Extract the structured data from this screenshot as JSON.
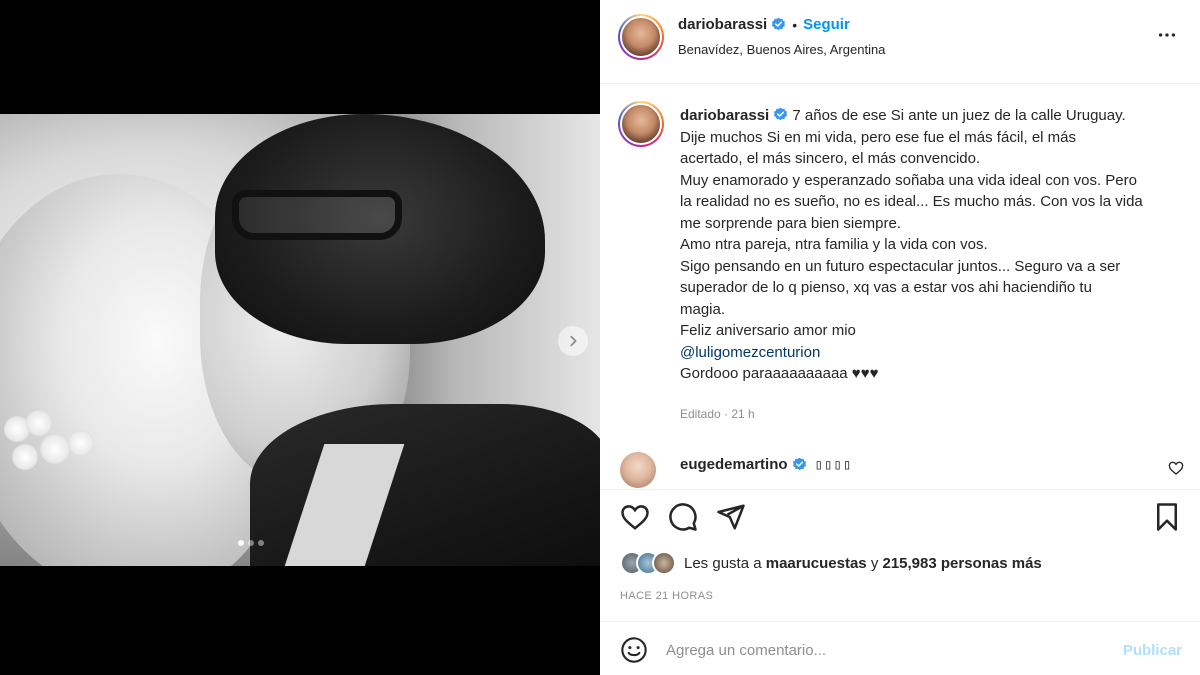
{
  "post": {
    "author": "dariobarassi",
    "location": "Benavídez, Buenos Aires, Argentina",
    "follow_label": "Seguir",
    "separator": "•",
    "caption_lines": [
      "7 años de ese Si ante un juez de la calle Uruguay.",
      "Dije muchos Si en mi vida, pero ese fue el más fácil, el más",
      "acertado, el más sincero, el más convencido.",
      "Muy enamorado y esperanzado soñaba una vida ideal con vos. Pero",
      "la realidad no es sueño, no es ideal... Es mucho más. Con vos la vida",
      "me sorprende para bien siempre.",
      "Amo ntra pareja, ntra familia y la vida con vos.",
      "Sigo pensando en un futuro espectacular juntos... Seguro va a ser",
      "superador de lo q pienso, xq vas a estar vos ahi haciendiño tu",
      "magia.",
      "Feliz aniversario amor mio"
    ],
    "mention": "@luligomezcenturion",
    "caption_last": "Gordooo paraaaaaaaaaa ♥♥♥",
    "edited": "Editado · 21 h",
    "carousel": {
      "slides": 3,
      "current": 1
    }
  },
  "comment": {
    "author": "eugedemartino",
    "text": "▯▯▯▯"
  },
  "likes": {
    "prefix": "Les gusta a",
    "user": "maarucuestas",
    "middle": "y",
    "count": "215,983 personas más"
  },
  "time": "HACE 21 HORAS",
  "add_comment": {
    "placeholder": "Agrega un comentario...",
    "publish_label": "Publicar"
  },
  "icons": [
    "more-options-icon",
    "verified-badge-icon",
    "like-icon",
    "comment-icon",
    "share-icon",
    "save-icon",
    "emoji-icon",
    "chevron-right-icon"
  ],
  "colors": {
    "link_blue": "#0095f6",
    "verified_blue": "#3897f0",
    "publish_disabled": "#b2dffc",
    "mention": "#00376b",
    "muted": "#8e8e8e"
  }
}
